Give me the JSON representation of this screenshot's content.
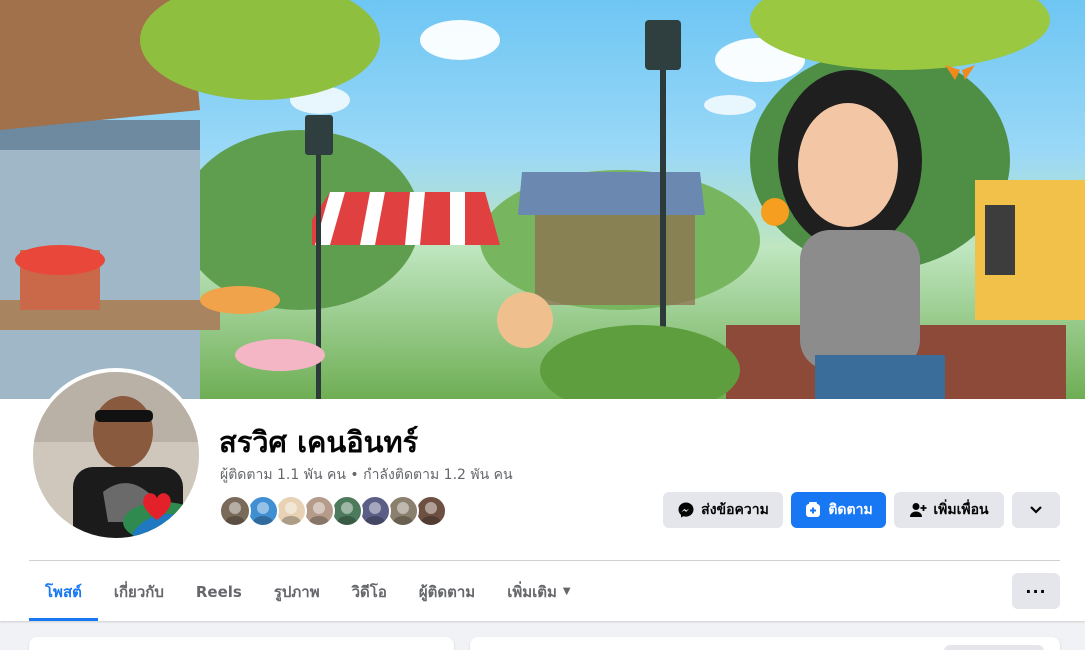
{
  "profile": {
    "name": "สรวิศ เคนอินทร์",
    "followers_text": "ผู้ติดตาม 1.1 พัน คน",
    "separator": "•",
    "following_text": "กำลังติดตาม 1.2 พัน คน"
  },
  "actions": {
    "message_label": "ส่งข้อความ",
    "follow_label": "ติดตาม",
    "add_friend_label": "เพิ่มเพื่อน"
  },
  "friend_avatars": [
    {
      "name": "friend-avatar-1",
      "color": "#7a6a5a"
    },
    {
      "name": "friend-avatar-2",
      "color": "#3f8fd2"
    },
    {
      "name": "friend-avatar-3",
      "color": "#e7d2b5"
    },
    {
      "name": "friend-avatar-4",
      "color": "#b59c8a"
    },
    {
      "name": "friend-avatar-5",
      "color": "#4d7a5c"
    },
    {
      "name": "friend-avatar-6",
      "color": "#5b5f86"
    },
    {
      "name": "friend-avatar-7",
      "color": "#8b7f6d"
    },
    {
      "name": "friend-avatar-8",
      "color": "#6d5042"
    }
  ],
  "tabs": [
    {
      "label": "โพสต์",
      "active": true
    },
    {
      "label": "เกี่ยวกับ",
      "active": false
    },
    {
      "label": "Reels",
      "active": false
    },
    {
      "label": "รูปภาพ",
      "active": false
    },
    {
      "label": "วิดีโอ",
      "active": false
    },
    {
      "label": "ผู้ติดตาม",
      "active": false
    },
    {
      "label": "เพิ่มเติม",
      "active": false,
      "caret": "▼"
    }
  ],
  "more_button": "···",
  "colors": {
    "accent": "#1877f2",
    "button_gray": "#e4e6eb",
    "muted_text": "#65676b"
  },
  "icons": [
    "messenger-icon",
    "follow-icon",
    "add-friend-icon",
    "chevron-down-icon",
    "more-dots-icon",
    "heart-icon"
  ]
}
